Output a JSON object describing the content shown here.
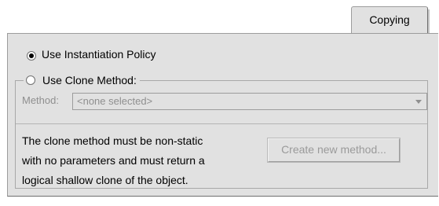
{
  "tab": {
    "label": "Copying"
  },
  "policy": {
    "instantiation_label": "Use Instantiation Policy",
    "instantiation_selected": true,
    "clone_label": "Use Clone Method:",
    "clone_selected": false
  },
  "clone_method": {
    "method_label": "Method:",
    "select_value": "<none selected>",
    "description_lines": [
      "The clone method must be non-static",
      "with no parameters and must return a",
      "logical shallow clone of the object."
    ],
    "create_button_label": "Create new method..."
  },
  "colors": {
    "panel_bg": "#e1e1e1",
    "disabled_text": "#8f8f8f"
  }
}
